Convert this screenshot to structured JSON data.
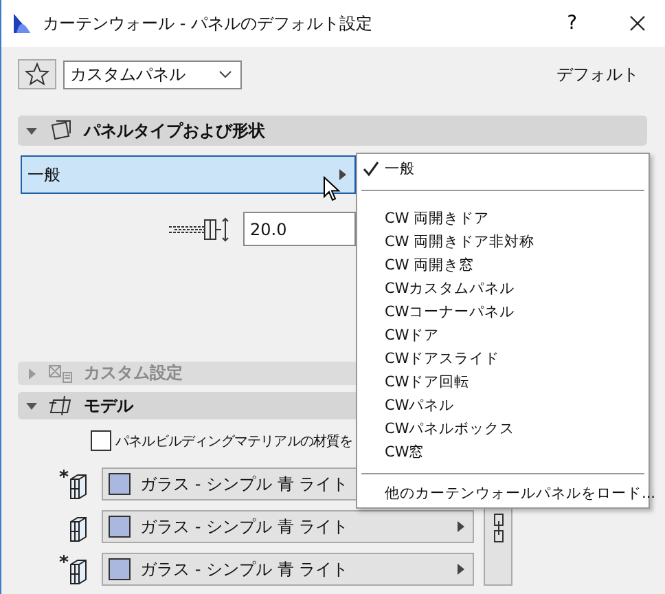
{
  "window": {
    "title": "カーテンウォール - パネルのデフォルト設定",
    "help": "?"
  },
  "toolbar": {
    "preset": "カスタムパネル",
    "default_label": "デフォルト"
  },
  "panel_type_section": {
    "title": "パネルタイプおよび形状",
    "expanded": true,
    "type_value": "一般",
    "thickness": "20.0"
  },
  "custom_section": {
    "title": "カスタム設定",
    "expanded": false,
    "disabled": true
  },
  "model_section": {
    "title": "モデル",
    "expanded": true,
    "checkbox": {
      "label": "パネルビルディングマテリアルの材質を",
      "checked": false
    },
    "materials": [
      {
        "label": "ガラス - シンプル 青 ライト",
        "kind": "star"
      },
      {
        "label": "ガラス - シンプル 青 ライト",
        "kind": "plain"
      },
      {
        "label": "ガラス - シンプル 青 ライト",
        "kind": "star"
      }
    ]
  },
  "type_menu": {
    "groups": [
      {
        "items": [
          {
            "label": "一般",
            "selected": true
          }
        ]
      },
      {
        "items": [
          {
            "label": "CW 両開きドア",
            "selected": false
          },
          {
            "label": "CW 両開きドア非対称",
            "selected": false
          },
          {
            "label": "CW 両開き窓",
            "selected": false
          },
          {
            "label": "CWカスタムパネル",
            "selected": false
          },
          {
            "label": "CWコーナーパネル",
            "selected": false
          },
          {
            "label": "CWドア",
            "selected": false
          },
          {
            "label": "CWドアスライド",
            "selected": false
          },
          {
            "label": "CWドア回転",
            "selected": false
          },
          {
            "label": "CWパネル",
            "selected": false
          },
          {
            "label": "CWパネルボックス",
            "selected": false
          },
          {
            "label": "CW窓",
            "selected": false
          }
        ]
      },
      {
        "items": [
          {
            "label": "他のカーテンウォールパネルをロード...",
            "selected": false
          }
        ]
      }
    ]
  }
}
